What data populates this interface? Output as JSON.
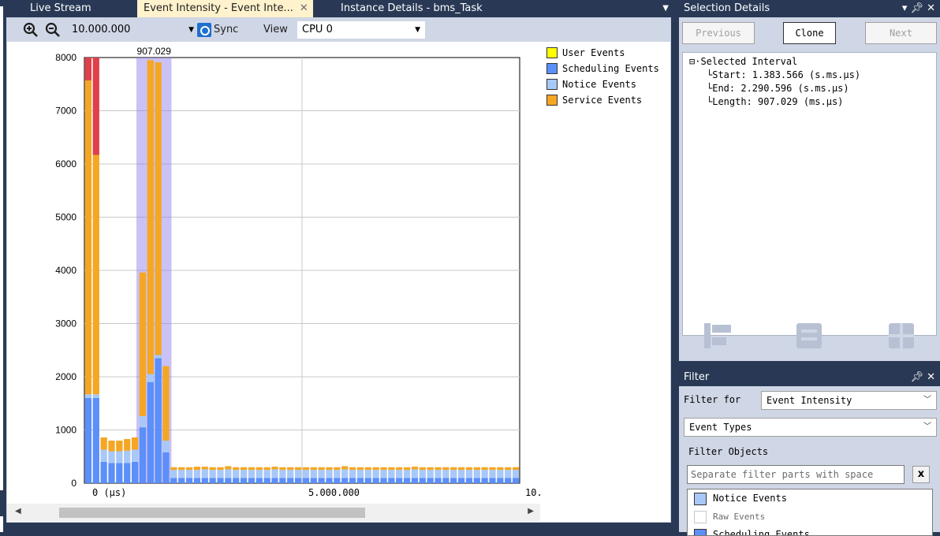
{
  "tabs": [
    {
      "label": "Live Stream"
    },
    {
      "label": "Event Intensity - Event Inte...",
      "close": "✕"
    },
    {
      "label": "Instance Details - bms_Task"
    }
  ],
  "toolbar": {
    "zoom_value": "10.000.000",
    "sync_label": "Sync",
    "view_label": "View",
    "cpu_value": "CPU 0"
  },
  "legend": [
    {
      "label": "User Events",
      "color": "#ffff00"
    },
    {
      "label": "Scheduling Events",
      "color": "#5b8ff9"
    },
    {
      "label": "Notice Events",
      "color": "#a8c8f8"
    },
    {
      "label": "Service Events",
      "color": "#f5a623"
    }
  ],
  "chart_data": {
    "type": "bar",
    "stacked": true,
    "ylim": [
      0,
      8000
    ],
    "yticks": [
      0,
      1000,
      2000,
      3000,
      4000,
      5000,
      6000,
      7000,
      8000
    ],
    "xticks": [
      "0 (µs)",
      "5.000.000",
      "10."
    ],
    "selection_label": "907.029",
    "grid": true,
    "series": [
      {
        "name": "Scheduling Events",
        "color": "#5b8ff9",
        "values": [
          1600,
          1600,
          400,
          380,
          380,
          380,
          400,
          1050,
          1900,
          2350,
          580,
          100,
          100,
          100,
          100,
          100,
          100,
          100,
          100,
          100,
          100,
          100,
          100,
          100,
          100,
          100,
          100,
          100,
          100,
          100,
          100,
          100,
          100,
          100,
          100,
          100,
          100,
          100,
          100,
          100,
          100,
          100,
          100,
          100,
          100,
          100,
          100,
          100,
          100,
          100,
          100,
          100,
          100,
          100,
          100,
          100
        ]
      },
      {
        "name": "Notice Events",
        "color": "#a8c8f8",
        "values": [
          70,
          70,
          230,
          220,
          220,
          230,
          230,
          210,
          150,
          60,
          220,
          150,
          150,
          150,
          150,
          160,
          150,
          150,
          160,
          150,
          150,
          150,
          150,
          150,
          160,
          150,
          150,
          150,
          150,
          150,
          150,
          150,
          150,
          160,
          150,
          150,
          150,
          150,
          150,
          150,
          150,
          150,
          160,
          150,
          150,
          150,
          150,
          150,
          150,
          150,
          150,
          150,
          150,
          150,
          150,
          150
        ]
      },
      {
        "name": "Service Events",
        "color": "#f5a623",
        "values": [
          5900,
          4500,
          230,
          200,
          200,
          220,
          230,
          2700,
          5900,
          5500,
          1400,
          50,
          50,
          50,
          60,
          50,
          50,
          50,
          60,
          50,
          50,
          50,
          50,
          50,
          50,
          50,
          50,
          50,
          50,
          50,
          50,
          50,
          50,
          60,
          50,
          50,
          50,
          50,
          50,
          50,
          50,
          50,
          50,
          50,
          50,
          50,
          50,
          50,
          50,
          50,
          50,
          50,
          50,
          50,
          50,
          50
        ]
      },
      {
        "name": "User Events",
        "color": "#e0404a",
        "values": [
          430,
          1830,
          0,
          0,
          0,
          0,
          0,
          0,
          0,
          0,
          0,
          0,
          0,
          0,
          0,
          0,
          0,
          0,
          0,
          0,
          0,
          0,
          0,
          0,
          0,
          0,
          0,
          0,
          0,
          0,
          0,
          0,
          0,
          0,
          0,
          0,
          0,
          0,
          0,
          0,
          0,
          0,
          0,
          0,
          0,
          0,
          0,
          0,
          0,
          0,
          0,
          0,
          0,
          0,
          0,
          0
        ]
      }
    ]
  },
  "selection_panel": {
    "title": "Selection Details",
    "prev_label": "Previous",
    "clone_label": "Clone",
    "next_label": "Next",
    "tree_root": "Selected Interval",
    "tree_items": [
      "Start: 1.383.566 (s.ms.µs)",
      "End: 2.290.596 (s.ms.µs)",
      "Length: 907.029 (ms.µs)"
    ]
  },
  "filter_panel": {
    "title": "Filter",
    "filter_for_label": "Filter for",
    "filter_for_value": "Event Intensity",
    "event_types_value": "Event Types",
    "filter_objects_label": "Filter Objects",
    "input_placeholder": "Separate filter parts with space",
    "clear_label": "x",
    "items": [
      {
        "label": "Notice Events",
        "color": "#a8c8f8"
      },
      {
        "label": "Raw Events",
        "color": "#ffffff"
      },
      {
        "label": "Scheduling Events",
        "color": "#5b8ff9"
      }
    ]
  }
}
